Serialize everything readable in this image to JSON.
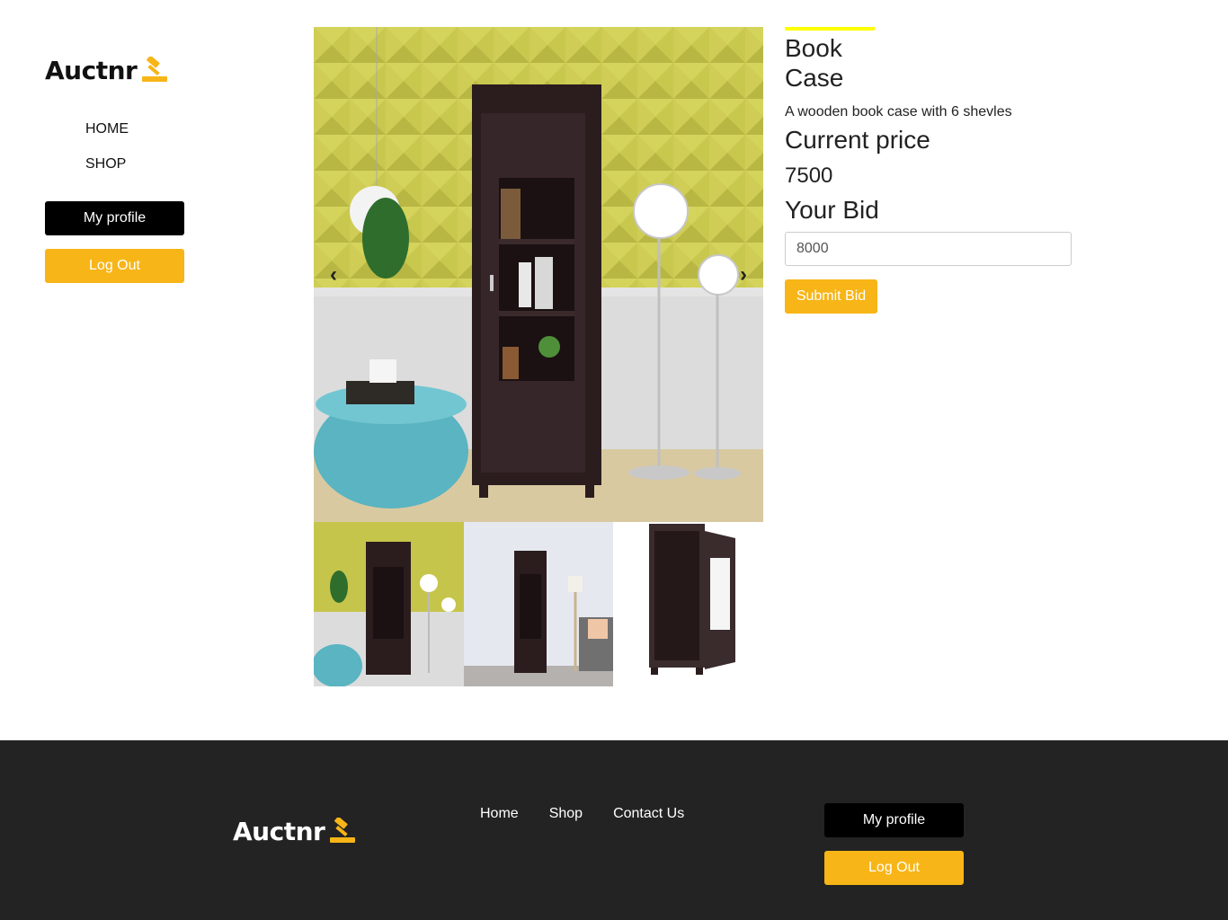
{
  "brand": {
    "name": "Auctnr",
    "logo_icon": "gavel-icon"
  },
  "nav": {
    "items": [
      {
        "label": "HOME"
      },
      {
        "label": "SHOP"
      }
    ]
  },
  "sidebar_buttons": {
    "profile": "My profile",
    "logout": "Log Out"
  },
  "gallery": {
    "prev_glyph": "‹",
    "next_glyph": "›",
    "thumbnails": [
      "bookcase-room-yellow",
      "bookcase-room-white",
      "bookcase-open-door"
    ]
  },
  "product": {
    "title": "Book Case",
    "description": "A wooden book case with 6 shevles",
    "current_price_label": "Current price",
    "current_price": "7500",
    "bid_label": "Your Bid",
    "bid_value": "8000",
    "submit_label": "Submit Bid"
  },
  "footer": {
    "links": [
      {
        "label": "Home"
      },
      {
        "label": "Shop"
      },
      {
        "label": "Contact Us"
      }
    ],
    "profile": "My profile",
    "logout": "Log Out"
  },
  "colors": {
    "accent": "#f7b517",
    "accent_bar": "#ffff00",
    "footer_bg": "#232323",
    "dark_button": "#000000"
  }
}
